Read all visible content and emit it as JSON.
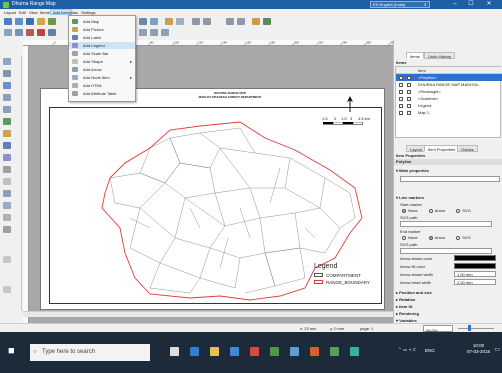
{
  "window": {
    "title": "Dhurna Range Map",
    "language": "EN English (India)",
    "minimize": "–",
    "maximize": "☐",
    "close": "✕"
  },
  "menubar": {
    "items": [
      "Layout",
      "Edit",
      "View",
      "Items",
      "Add Item",
      "Atlas",
      "Settings"
    ],
    "active": "Add Item"
  },
  "add_item_menu": {
    "items": [
      {
        "label": "Add Map",
        "icon": "map-icon"
      },
      {
        "label": "Add Picture",
        "icon": "picture-icon"
      },
      {
        "label": "Add Label",
        "icon": "label-icon"
      },
      {
        "label": "Add Legend",
        "icon": "legend-icon",
        "highlighted": true
      },
      {
        "label": "Add Scale Bar",
        "icon": "scale-bar-icon"
      },
      {
        "label": "Add Shape",
        "icon": "shape-icon",
        "submenu": true
      },
      {
        "label": "Add Arrow",
        "icon": "arrow-icon"
      },
      {
        "label": "Add Node Item",
        "icon": "node-icon",
        "submenu": true
      },
      {
        "label": "Add HTML",
        "icon": "html-icon"
      },
      {
        "label": "Add Attribute Table",
        "icon": "table-icon"
      }
    ]
  },
  "map": {
    "title_line1": "DHURNA RANGE MAP",
    "title_line2": "MADHYA PRADESH FOREST DEPARTMENT",
    "scale_labels": [
      "1.5",
      "0",
      "1.5",
      "3",
      "4.5 km"
    ],
    "north": "N",
    "legend_title": "Legend",
    "legend_items": [
      {
        "label": "COMPARTMENT",
        "color": "#ffffff"
      },
      {
        "label": "RANGE_BOUNDARY",
        "color": "#e03c3c"
      }
    ]
  },
  "ruler": {
    "ticks": [
      "0",
      "20",
      "40",
      "60",
      "80",
      "100",
      "120",
      "140",
      "160",
      "180",
      "200",
      "220",
      "240",
      "260",
      "280"
    ]
  },
  "items_panel": {
    "tabs": [
      "Items",
      "Undo History"
    ],
    "header": "Items",
    "columns": [
      "",
      "",
      "Item"
    ],
    "rows": [
      "<Polyline>",
      "DHURNA RANGE MAP MADHYA...",
      "<Rectangle>",
      "<Scalebar>",
      "Legend",
      "Map 1"
    ]
  },
  "props_panel": {
    "tabs": [
      "Layout",
      "Item Properties",
      "Guides"
    ],
    "header": "Item Properties",
    "item_type": "Polyline",
    "main_properties": "Main properties",
    "line_markers": "Line markers",
    "start_marker": "Start marker",
    "end_marker": "End marker",
    "marker_options": [
      "None",
      "Arrow",
      "SVG"
    ],
    "start_selected": "None",
    "end_selected": "Arrow",
    "svg_path": "SVG path",
    "arrow_stroke_color": "Arrow stroke color",
    "arrow_fill_color": "Arrow fill color",
    "arrow_stroke_width_label": "Arrow stroke width",
    "arrow_stroke_width": "1.00 mm",
    "arrow_head_width_label": "Arrow head width",
    "arrow_head_width": "2.00 mm",
    "sections": [
      "Position and size",
      "Rotation",
      "Item ID",
      "Rendering",
      "Variables"
    ],
    "variables_columns": [
      "Variable",
      "Value"
    ]
  },
  "status": {
    "x": "x: 23 mm",
    "y": "y: 0 mm",
    "page": "page: 1",
    "zoom": "35.0%"
  },
  "taskbar": {
    "search_placeholder": "Type here to search",
    "time": "10:00",
    "date": "07-03-2018",
    "lang": "ENG"
  },
  "colors": {
    "titlebar": "#1f5fa6",
    "boundary": "#e03c3c",
    "taskbar": "#1c2a3a",
    "highlight": "#cce4f7"
  }
}
